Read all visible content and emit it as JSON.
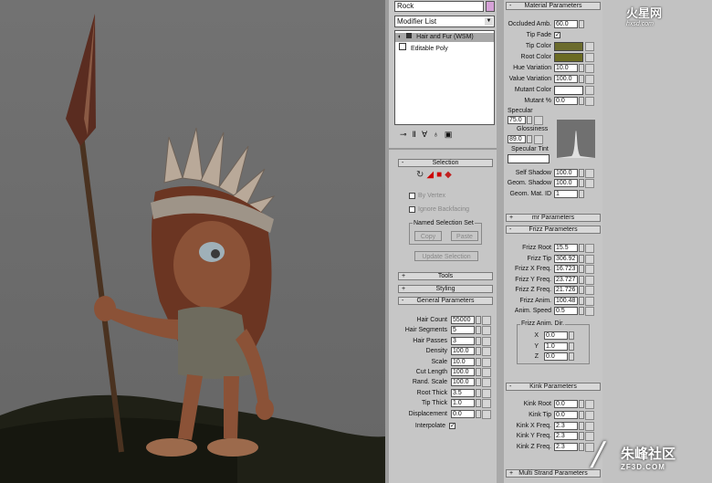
{
  "watermarks": {
    "top_brand": "火星网",
    "top_url": "hxsd.com",
    "bottom_brand": "朱峰社区",
    "bottom_url": "ZF3D.COM"
  },
  "modify_panel": {
    "object_name": "Rock",
    "object_color": "#d6a2d8",
    "modifier_list_label": "Modifier List",
    "stack": [
      "Hair and Fur (WSM)",
      "Editable Poly"
    ],
    "selection": {
      "title": "Selection",
      "by_vertex": "By Vertex",
      "ignore_backfacing": "Ignore Backfacing",
      "named_selection_set": "Named Selection Set",
      "copy": "Copy",
      "paste": "Paste",
      "update_selection": "Update Selection"
    },
    "tools": "Tools",
    "styling": "Styling",
    "general": {
      "title": "General Parameters",
      "rows": [
        {
          "label": "Hair Count",
          "value": "55000"
        },
        {
          "label": "Hair Segments",
          "value": "5"
        },
        {
          "label": "Hair Passes",
          "value": "3"
        },
        {
          "label": "Density",
          "value": "100.0"
        },
        {
          "label": "Scale",
          "value": "10.0"
        },
        {
          "label": "Cut Length",
          "value": "100.0"
        },
        {
          "label": "Rand. Scale",
          "value": "100.0"
        },
        {
          "label": "Root Thick",
          "value": "3.5"
        },
        {
          "label": "Tip Thick",
          "value": "1.0"
        },
        {
          "label": "Displacement",
          "value": "0.0"
        }
      ],
      "interpolate": "Interpolate"
    }
  },
  "material": {
    "title": "Material Parameters",
    "occluded_amb": {
      "label": "Occluded Amb.",
      "value": "60.0"
    },
    "tip_fade": "Tip Fade",
    "tip_color": {
      "label": "Tip Color",
      "color": "#6b6b2c"
    },
    "root_color": {
      "label": "Root Color",
      "color": "#6b6b22"
    },
    "hue_variation": {
      "label": "Hue Variation",
      "value": "10.0"
    },
    "value_variation": {
      "label": "Value Variation",
      "value": "100.0"
    },
    "mutant_color": {
      "label": "Mutant Color",
      "color": "#ffffff"
    },
    "mutant_pct": {
      "label": "Mutant %",
      "value": "0.0"
    },
    "specular": {
      "label": "Specular",
      "value": "75.0"
    },
    "glossiness": {
      "label": "Glossiness",
      "value": "89.0"
    },
    "specular_tint": {
      "label": "Specular Tint",
      "color": "#ffffff"
    },
    "self_shadow": {
      "label": "Self Shadow",
      "value": "100.0"
    },
    "geom_shadow": {
      "label": "Geom. Shadow",
      "value": "100.0"
    },
    "geom_mat_id": {
      "label": "Geom. Mat. ID",
      "value": "1"
    }
  },
  "mr_parameters": "mr Parameters",
  "frizz": {
    "title": "Frizz Parameters",
    "rows": [
      {
        "label": "Frizz Root",
        "value": "15.5"
      },
      {
        "label": "Frizz Tip",
        "value": "306.92"
      },
      {
        "label": "Frizz X Freq.",
        "value": "16.723"
      },
      {
        "label": "Frizz Y Freq.",
        "value": "23.727"
      },
      {
        "label": "Frizz Z Freq.",
        "value": "21.726"
      },
      {
        "label": "Frizz Anim.",
        "value": "100.48"
      },
      {
        "label": "Anim. Speed",
        "value": "0.5"
      }
    ],
    "anim_dir": "Frizz Anim. Dir.",
    "dir": [
      {
        "label": "X",
        "value": "0.0"
      },
      {
        "label": "Y",
        "value": "1.0"
      },
      {
        "label": "Z",
        "value": "0.0"
      }
    ]
  },
  "kink": {
    "title": "Kink Parameters",
    "rows": [
      {
        "label": "Kink Root",
        "value": "0.0"
      },
      {
        "label": "Kink Tip",
        "value": "0.0"
      },
      {
        "label": "Kink X Freq.",
        "value": "2.3"
      },
      {
        "label": "Kink Y Freq.",
        "value": "2.3"
      },
      {
        "label": "Kink Z Freq.",
        "value": "2.3"
      }
    ]
  },
  "multi_strand": "Multi Strand Parameters"
}
